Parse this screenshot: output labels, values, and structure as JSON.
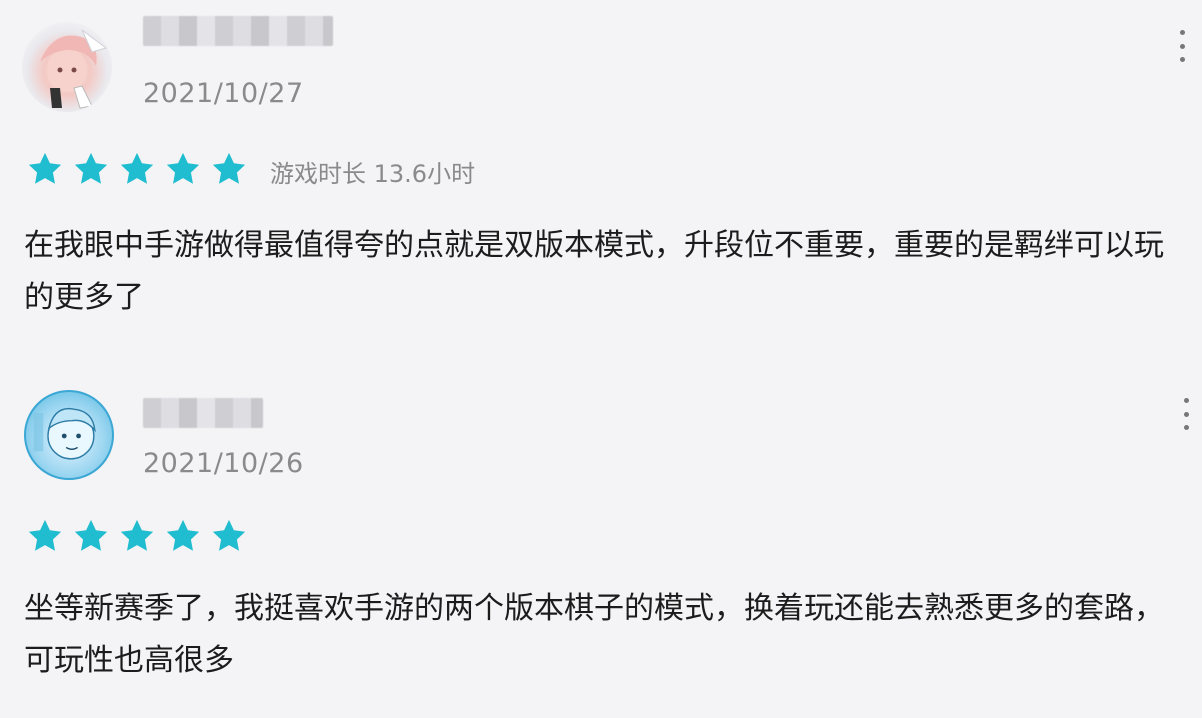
{
  "reviews": [
    {
      "date": "2021/10/27",
      "rating_stars": 5,
      "playtime": "游戏时长 13.6小时",
      "content": "在我眼中手游做得最值得夸的点就是双版本模式，升段位不重要，重要的是羁绊可以玩的更多了",
      "avatar_icon": "avatar-anime-girl-icon",
      "more_icon": "more-vertical-icon"
    },
    {
      "date": "2021/10/26",
      "rating_stars": 5,
      "content": "坐等新赛季了，我挺喜欢手游的两个版本棋子的模式，换着玩还能去熟悉更多的套路，可玩性也高很多",
      "avatar_icon": "avatar-cartoon-boy-icon",
      "more_icon": "more-vertical-icon"
    }
  ],
  "colors": {
    "star": "#1fbdcf",
    "background": "#f4f4f6",
    "meta_text": "#8a8a8e",
    "body_text": "#1c1c1c"
  }
}
